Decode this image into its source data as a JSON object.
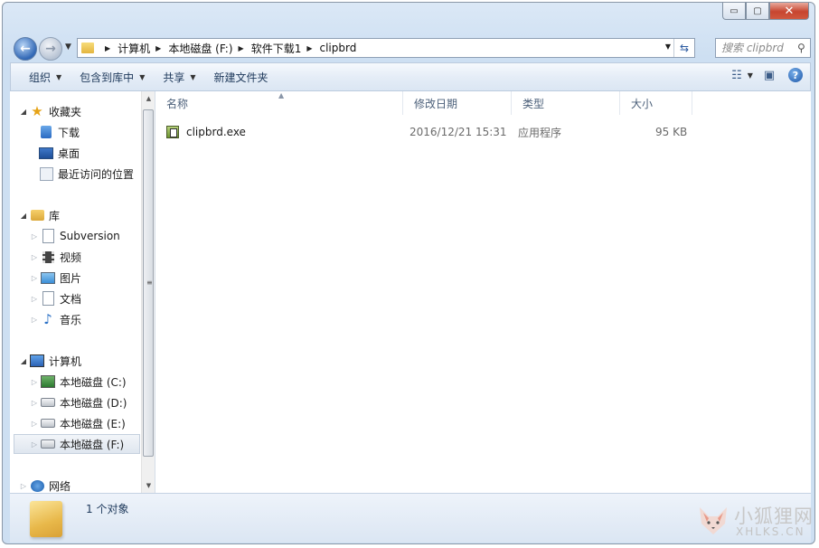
{
  "window": {
    "minimize_glyph": "▭",
    "maximize_glyph": "▢",
    "close_glyph": "✕"
  },
  "address": {
    "breadcrumbs": [
      "计算机",
      "本地磁盘 (F:)",
      "软件下载1",
      "clipbrd"
    ]
  },
  "search": {
    "placeholder": "搜索 clipbrd"
  },
  "toolbar": {
    "organize": "组织",
    "include_in_library": "包含到库中",
    "share": "共享",
    "new_folder": "新建文件夹"
  },
  "nav_pane": {
    "favorites": {
      "label": "收藏夹",
      "items": [
        "下载",
        "桌面",
        "最近访问的位置"
      ]
    },
    "libraries": {
      "label": "库",
      "items": [
        "Subversion",
        "视频",
        "图片",
        "文档",
        "音乐"
      ]
    },
    "computer": {
      "label": "计算机",
      "items": [
        "本地磁盘 (C:)",
        "本地磁盘 (D:)",
        "本地磁盘 (E:)",
        "本地磁盘 (F:)"
      ]
    },
    "network": {
      "label": "网络"
    },
    "selected_item": "本地磁盘 (F:)"
  },
  "columns": {
    "name": "名称",
    "date": "修改日期",
    "type": "类型",
    "size": "大小"
  },
  "files": [
    {
      "name": "clipbrd.exe",
      "modified": "2016/12/21 15:31",
      "type": "应用程序",
      "size": "95 KB",
      "icon": "exe-icon"
    }
  ],
  "details": {
    "count": "1 个对象"
  },
  "watermark": {
    "cn": "小狐狸网",
    "en": "XHLKS.CN"
  },
  "colors": {
    "accent": "#1e395b",
    "window_frame": "#cddff2",
    "close_button": "#c7452f"
  }
}
